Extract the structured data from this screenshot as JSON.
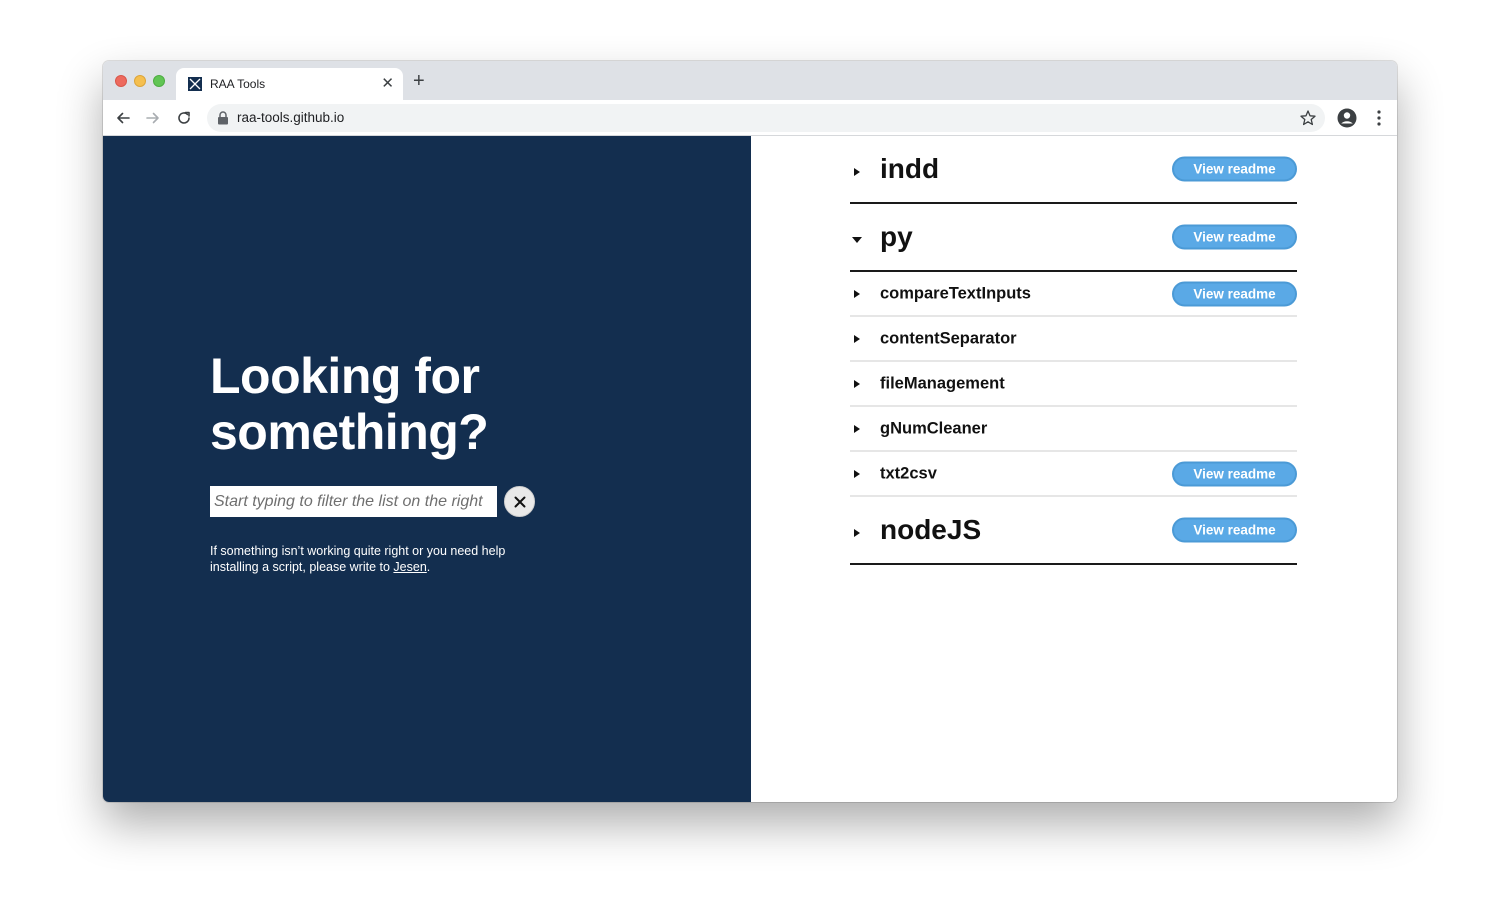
{
  "browser": {
    "tab_title": "RAA Tools",
    "tab_close": "✕",
    "new_tab": "+",
    "url": "raa-tools.github.io"
  },
  "sidebar": {
    "headline": "Looking for something?",
    "filter_placeholder": "Start typing to filter the list on the right",
    "clear_symbol": "✕",
    "help_prefix": "If something isn’t working quite right or you need help installing a script, please write to ",
    "help_link": "Jesen",
    "help_suffix": "."
  },
  "colors": {
    "sidebar_bg": "#132e4f",
    "button_bg": "#5aa9e6"
  },
  "list": {
    "items": [
      {
        "name": "indd",
        "level": "major",
        "expanded": false,
        "readme": "View readme"
      },
      {
        "name": "py",
        "level": "major",
        "expanded": true,
        "readme": "View readme"
      },
      {
        "name": "compareTextInputs",
        "level": "minor",
        "expanded": false,
        "readme": "View readme"
      },
      {
        "name": "contentSeparator",
        "level": "minor",
        "expanded": false,
        "readme": ""
      },
      {
        "name": "fileManagement",
        "level": "minor",
        "expanded": false,
        "readme": ""
      },
      {
        "name": "gNumCleaner",
        "level": "minor",
        "expanded": false,
        "readme": ""
      },
      {
        "name": "txt2csv",
        "level": "minor",
        "expanded": false,
        "readme": "View readme"
      },
      {
        "name": "nodeJS",
        "level": "major",
        "expanded": false,
        "readme": "View readme"
      }
    ]
  }
}
